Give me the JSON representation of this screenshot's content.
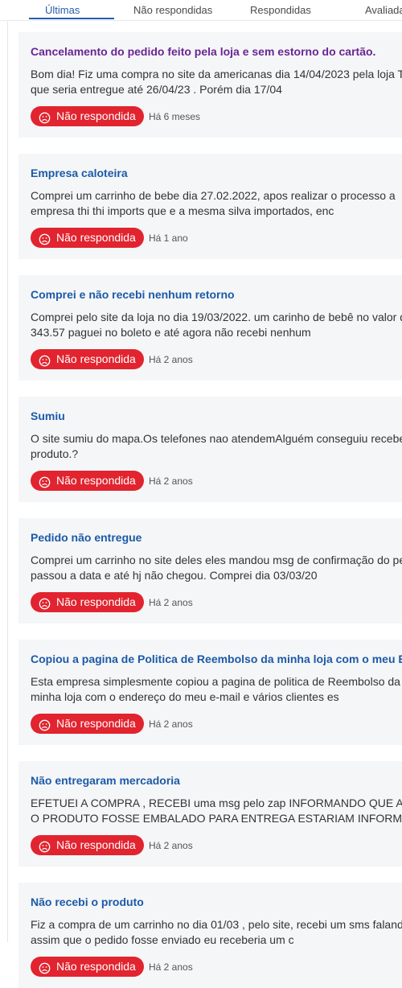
{
  "tabs": [
    {
      "label": "Últimas",
      "active": true
    },
    {
      "label": "Não respondidas",
      "active": false
    },
    {
      "label": "Respondidas",
      "active": false
    },
    {
      "label": "Avaliadas",
      "active": false
    }
  ],
  "status_icon": "sad-face-icon",
  "colors": {
    "accent": "#2a5da8",
    "title_link": "#1c5aa8",
    "title_visited": "#6a2595",
    "status_badge": "#e1242f",
    "card_background": "#f5f6f7"
  },
  "complaints": [
    {
      "title": "Cancelamento do pedido feito pela loja e sem estorno do cartão.",
      "lines": [
        "Bom dia! Fiz uma compra no site da americanas dia 14/04/2023 pela loja THIT",
        "que seria entregue até 26/04/23 . Porém dia 17/04"
      ],
      "status": "Não respondida",
      "time": "Há 6 meses"
    },
    {
      "title": "Empresa caloteira",
      "lines": [
        "Comprei um carrinho de bebe dia 27.02.2022, apos realizar o processo a",
        "empresa thi thi imports que e a mesma silva importados, enc"
      ],
      "status": "Não respondida",
      "time": "Há 1 ano"
    },
    {
      "title": "Comprei e não recebi nenhum retorno",
      "lines": [
        "Comprei pelo site da loja no dia 19/03/2022. um carinho de bebê no valor de",
        "343.57 paguei no boleto e até agora não recebi nenhum"
      ],
      "status": "Não respondida",
      "time": "Há 2 anos"
    },
    {
      "title": "Sumiu",
      "lines": [
        "O site sumiu do mapa.Os telefones nao atendemAlguém conseguiu receber se",
        "produto.?"
      ],
      "status": "Não respondida",
      "time": "Há 2 anos"
    },
    {
      "title": "Pedido não entregue",
      "lines": [
        "Comprei um carrinho no site deles eles mandou msg de confirmação do pedi",
        "passou a data e até hj não chegou. Comprei dia 03/03/20"
      ],
      "status": "Não respondida",
      "time": "Há 2 anos"
    },
    {
      "title": "Copiou a pagina de Politica de Reembolso da minha loja com o meu E-MAIL",
      "lines": [
        "Esta empresa simplesmente copiou a pagina de politica de Reembolso da",
        "minha loja com o endereço do meu e-mail e vários clientes es"
      ],
      "status": "Não respondida",
      "time": "Há 2 anos"
    },
    {
      "title": "Não entregaram mercadoria",
      "lines": [
        "EFETUEI A COMPRA , RECEBI uma msg pelo zap INFORMANDO QUE ASSIM QU",
        "O PRODUTO FOSSE EMBALADO PARA ENTREGA ESTARIAM INFORMANDO E AT"
      ],
      "status": "Não respondida",
      "time": "Há 2 anos"
    },
    {
      "title": "Não recebi o produto",
      "lines": [
        "Fiz a compra de um carrinho no dia 01/03 , pelo site, recebi um sms falando q",
        "assim que o pedido fosse enviado eu receberia um c"
      ],
      "status": "Não respondida",
      "time": "Há 2 anos"
    }
  ]
}
